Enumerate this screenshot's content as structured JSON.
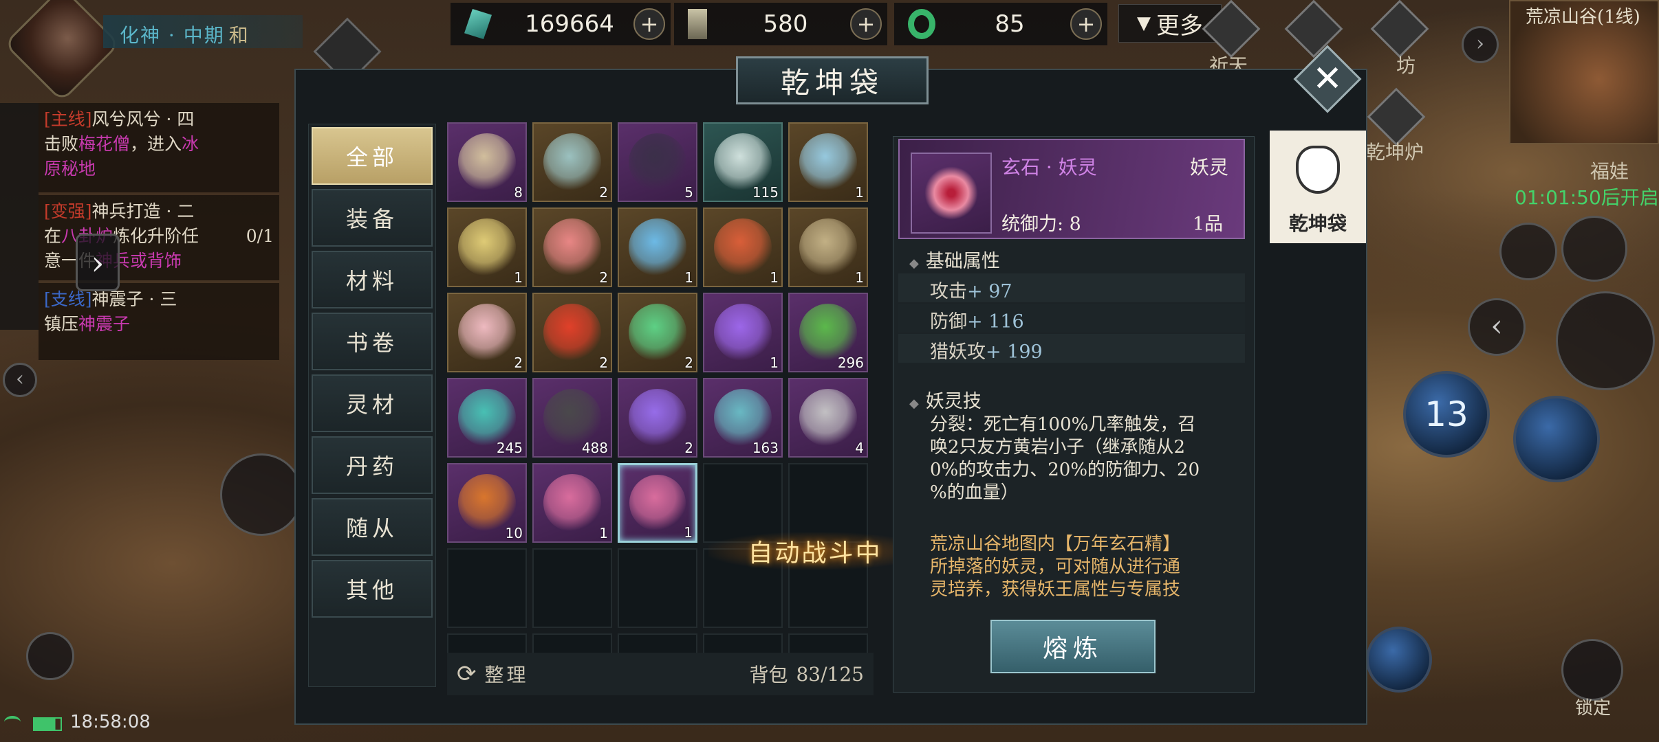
{
  "hud": {
    "rank": "化神 · 中期",
    "rank_suffix": "和",
    "resources": [
      {
        "icon": "jade-crystal-icon",
        "value": "169664"
      },
      {
        "icon": "token-icon",
        "value": "580"
      },
      {
        "icon": "green-ring-icon",
        "value": "85"
      }
    ],
    "more_label": "更多",
    "more_icon": "chevron-down-icon",
    "time": "18:58:08",
    "map_name": "荒凉山谷(1线)",
    "welfare_label": "福娃",
    "countdown": "01:01:50后开启",
    "lock_label": "锁定",
    "skill_level": "13",
    "side_labels": [
      "祈天",
      "坊",
      "乾坤炉"
    ]
  },
  "quests": [
    {
      "tag": "[主线]",
      "title": "风兮风兮 · 四",
      "line2a": "击败",
      "line2b": "梅花僧",
      "line2c": "，进入",
      "line2d": "冰",
      "line3": "原秘地"
    },
    {
      "tag": "[变强]",
      "title": "神兵打造 · 二",
      "line2a": "在",
      "line2b": "八卦炉",
      "line2c": "炼化升阶任",
      "progress": "0/1",
      "line3a": "意一件",
      "line3b": "神兵或背饰"
    },
    {
      "tag": "[支线]",
      "title": "神震子 · 三",
      "line2a": "镇压",
      "line2b": "神震子"
    }
  ],
  "bag": {
    "title": "乾坤袋",
    "close_icon": "close-icon",
    "tabs": [
      "全部",
      "装备",
      "材料",
      "书卷",
      "灵材",
      "丹药",
      "随从",
      "其他"
    ],
    "active_tab": "全部",
    "items": [
      {
        "icon": "scroll-icon",
        "count": "8",
        "rarity": "purple"
      },
      {
        "icon": "feather-icon",
        "count": "2",
        "rarity": "gold"
      },
      {
        "icon": "orb-creature-icon",
        "count": "5",
        "rarity": "purple"
      },
      {
        "icon": "vase-icon",
        "count": "115",
        "rarity": "cyan"
      },
      {
        "icon": "crystal-pile-icon",
        "count": "1",
        "rarity": "gold"
      },
      {
        "icon": "sand-bowl-icon",
        "count": "1",
        "rarity": "gold"
      },
      {
        "icon": "red-powder-icon",
        "count": "2",
        "rarity": "gold"
      },
      {
        "icon": "water-drop-icon",
        "count": "1",
        "rarity": "gold"
      },
      {
        "icon": "red-tree-icon",
        "count": "1",
        "rarity": "gold"
      },
      {
        "icon": "bamboo-icon",
        "count": "1",
        "rarity": "gold"
      },
      {
        "icon": "lotus-icon",
        "count": "2",
        "rarity": "gold"
      },
      {
        "icon": "flame-icon",
        "count": "2",
        "rarity": "gold"
      },
      {
        "icon": "green-drop-icon",
        "count": "2",
        "rarity": "gold"
      },
      {
        "icon": "purple-flower-icon",
        "count": "1",
        "rarity": "purple"
      },
      {
        "icon": "green-herb-icon",
        "count": "296",
        "rarity": "purple"
      },
      {
        "icon": "teal-leaf-icon",
        "count": "245",
        "rarity": "purple"
      },
      {
        "icon": "dark-stone-icon",
        "count": "488",
        "rarity": "purple"
      },
      {
        "icon": "purple-crystal-icon",
        "count": "2",
        "rarity": "purple"
      },
      {
        "icon": "teal-powder-icon",
        "count": "163",
        "rarity": "purple"
      },
      {
        "icon": "gray-powder-icon",
        "count": "4",
        "rarity": "purple"
      },
      {
        "icon": "amber-crystal-icon",
        "count": "10",
        "rarity": "purple"
      },
      {
        "icon": "spirit-spore-icon",
        "count": "1",
        "rarity": "purple"
      },
      {
        "icon": "spirit-spore-icon",
        "count": "1",
        "rarity": "purple",
        "selected": true
      }
    ],
    "sort_label": "整理",
    "sort_icon": "refresh-icon",
    "capacity_label": "背包",
    "capacity": "83/125",
    "auto_battle": "自动战斗中",
    "side_tab": "乾坤袋"
  },
  "detail": {
    "name": "玄石 · 妖灵",
    "type": "妖灵",
    "control_label": "统御力: 8",
    "grade": "1品",
    "base_title": "基础属性",
    "stats": [
      {
        "label": "攻击",
        "value": "+ 97"
      },
      {
        "label": "防御",
        "value": "+ 116"
      },
      {
        "label": "猎妖攻",
        "value": "+ 199"
      }
    ],
    "skill_title": "妖灵技",
    "skill_lines": [
      "分裂：死亡有100%几率触发，召",
      "唤2只友方黄岩小子（继承随从2",
      "0%的攻击力、20%的防御力、20",
      "%的血量）"
    ],
    "desc_lines": [
      "荒凉山谷地图内【万年玄石精】",
      "所掉落的妖灵，可对随从进行通",
      "灵培养，获得妖王属性与专属技"
    ],
    "action_label": "熔炼"
  },
  "colors": {
    "accent": "#5bb6c9",
    "purple": "#6a3a7c",
    "gold": "#d8c58f",
    "quest_tag": "#c43b2b",
    "pink": "#c93ab0",
    "desc": "#e7b66a"
  }
}
